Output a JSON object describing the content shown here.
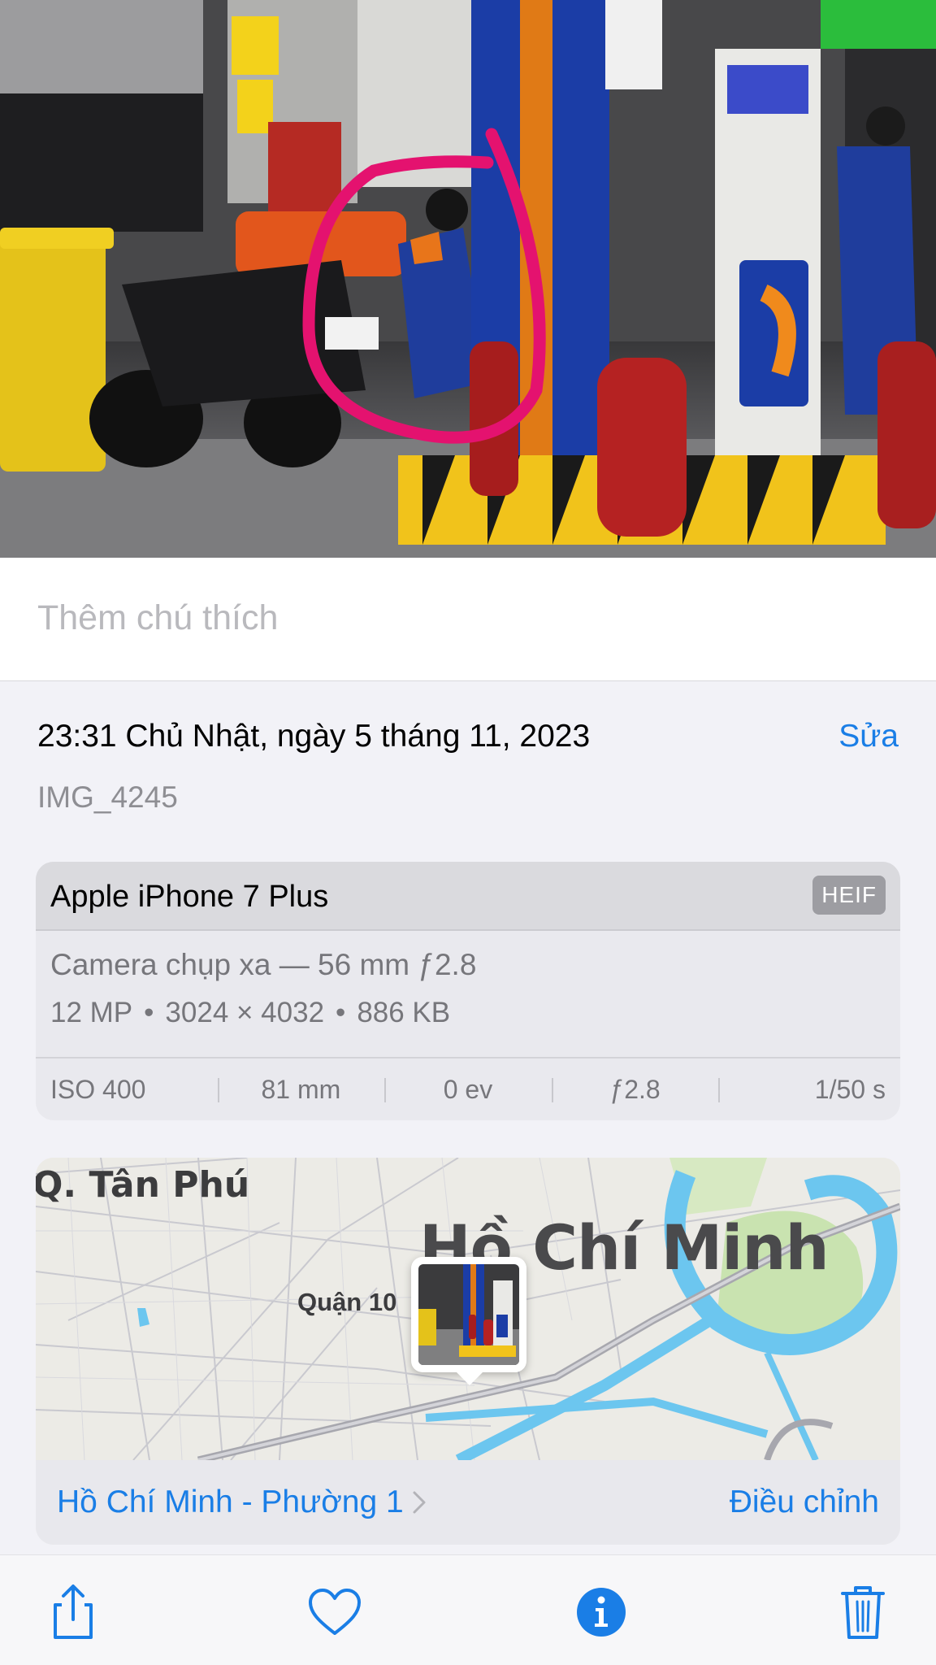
{
  "caption": {
    "placeholder": "Thêm chú thích"
  },
  "meta": {
    "datetime": "23:31 Chủ Nhật, ngày 5 tháng 11, 2023",
    "edit_label": "Sửa",
    "filename": "IMG_4245"
  },
  "camera": {
    "device": "Apple iPhone 7 Plus",
    "format_badge": "HEIF",
    "lens": "Camera chụp xa — 56 mm ƒ2.8",
    "megapixels": "12 MP",
    "resolution": "3024 × 4032",
    "filesize": "886 KB",
    "exif": {
      "iso": "ISO 400",
      "focal_length": "81 mm",
      "exposure_bias": "0 ev",
      "aperture": "ƒ2.8",
      "shutter": "1/50 s"
    }
  },
  "map": {
    "district_label": "Q. Tân Phú",
    "city_label": "Hồ Chí Minh",
    "quarter_label": "Quận 10",
    "location_link": "Hồ Chí Minh - Phường 1",
    "adjust_label": "Điều chỉnh"
  },
  "toolbar": {
    "icons": [
      "share-icon",
      "heart-icon",
      "info-icon",
      "trash-icon"
    ]
  },
  "colors": {
    "accent": "#1a7ee6",
    "annotation": "#e4126f",
    "station_blue": "#1c3fa8",
    "station_orange": "#f08a1c"
  }
}
